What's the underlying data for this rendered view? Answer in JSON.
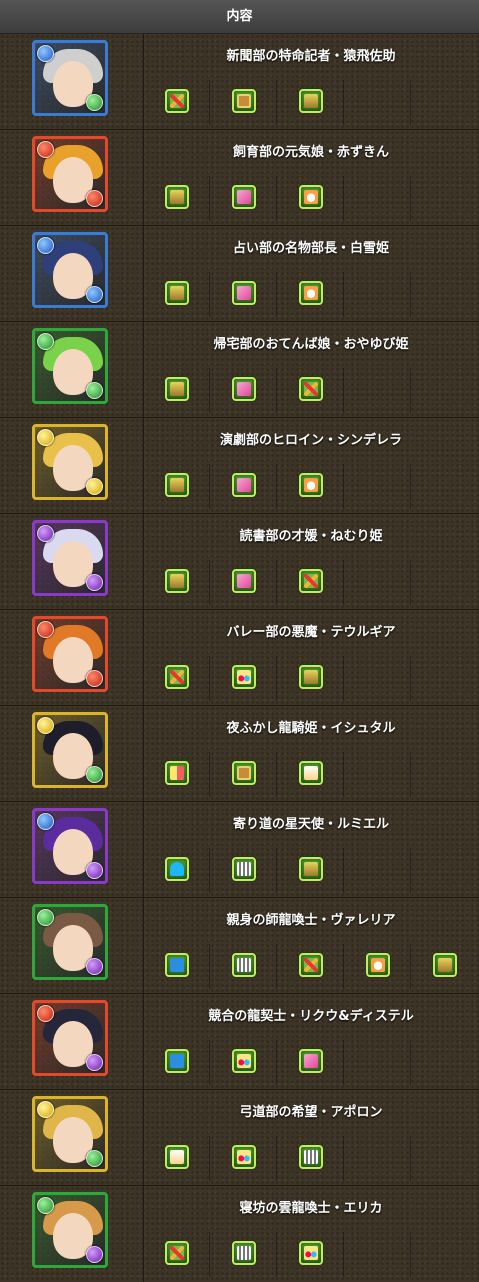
{
  "header": {
    "title": "内容"
  },
  "rows": [
    {
      "name": "新聞部の特命記者・猿飛佐助",
      "attrs": [
        "water",
        "wood"
      ],
      "frame": "#3a7bd5",
      "hair": "#cfcfcf",
      "skills": [
        "sb-cross-icon",
        "skill-boost-icon",
        "skill-boost-plus-icon"
      ]
    },
    {
      "name": "飼育部の元気娘・赤ずきん",
      "attrs": [
        "fire",
        "fire"
      ],
      "frame": "#e34a2b",
      "hair": "#e8a22c",
      "skills": [
        "skill-boost-plus-icon",
        "pink-arrow-icon",
        "egg-drop-icon"
      ]
    },
    {
      "name": "占い部の名物部長・白雪姫",
      "attrs": [
        "water",
        "water"
      ],
      "frame": "#3a7bd5",
      "hair": "#2f3f7a",
      "skills": [
        "skill-boost-plus-icon",
        "pink-arrow-icon",
        "egg-drop-icon"
      ]
    },
    {
      "name": "帰宅部のおてんば娘・おやゆび姫",
      "attrs": [
        "wood",
        "wood"
      ],
      "frame": "#2ea83a",
      "hair": "#7ad24a",
      "skills": [
        "skill-boost-plus-icon",
        "pink-arrow-icon",
        "sb-cross-icon"
      ]
    },
    {
      "name": "演劇部のヒロイン・シンデレラ",
      "attrs": [
        "light",
        "light"
      ],
      "frame": "#d8b52a",
      "hair": "#e8c04a",
      "skills": [
        "skill-boost-plus-icon",
        "pink-arrow-icon",
        "egg-drop-icon"
      ]
    },
    {
      "name": "読書部の才媛・ねむり姫",
      "attrs": [
        "dark",
        "dark"
      ],
      "frame": "#8a3ac8",
      "hair": "#d9d9f0",
      "skills": [
        "skill-boost-plus-icon",
        "pink-arrow-icon",
        "sb-cross-icon"
      ]
    },
    {
      "name": "バレー部の悪魔・テウルギア",
      "attrs": [
        "fire",
        "fire"
      ],
      "frame": "#e34a2b",
      "hair": "#e07a26",
      "skills": [
        "sb-cross-icon",
        "seven-combo-icon",
        "skill-boost-plus-icon"
      ]
    },
    {
      "name": "夜ふかし龍騎姫・イシュタル",
      "attrs": [
        "light",
        "wood"
      ],
      "frame": "#d8b52a",
      "hair": "#1e1e2a",
      "skills": [
        "bar-icon",
        "skill-boost-icon",
        "hand-plus-icon"
      ]
    },
    {
      "name": "寄り道の星天使・ルミエル",
      "attrs": [
        "water",
        "dark"
      ],
      "frame": "#8a3ac8",
      "hair": "#5a2c9e",
      "skills": [
        "u-turn-icon",
        "grid-icon",
        "skill-boost-plus-icon"
      ]
    },
    {
      "name": "親身の師龍喚士・ヴァレリア",
      "attrs": [
        "wood",
        "dark"
      ],
      "frame": "#2ea83a",
      "hair": "#7a5a44",
      "skills": [
        "s-plus-icon",
        "grid-icon",
        "sb-cross-icon",
        "egg-drop-icon",
        "skill-boost-plus-icon"
      ]
    },
    {
      "name": "競合の龍契士・リクウ&ディステル",
      "attrs": [
        "fire",
        "dark"
      ],
      "frame": "#e34a2b",
      "hair": "#26263a",
      "skills": [
        "s-plus-icon",
        "seven-combo-icon",
        "pink-arrow-icon"
      ]
    },
    {
      "name": "弓道部の希望・アポロン",
      "attrs": [
        "light",
        "wood"
      ],
      "frame": "#d8b52a",
      "hair": "#e0b64a",
      "skills": [
        "hand-plus-icon",
        "seven-combo-icon",
        "grid-icon"
      ]
    },
    {
      "name": "寝坊の雲龍喚士・エリカ",
      "attrs": [
        "wood",
        "dark"
      ],
      "frame": "#2ea83a",
      "hair": "#d69a4a",
      "skills": [
        "sb-cross-icon",
        "grid-icon",
        "seven-combo-icon"
      ]
    }
  ]
}
